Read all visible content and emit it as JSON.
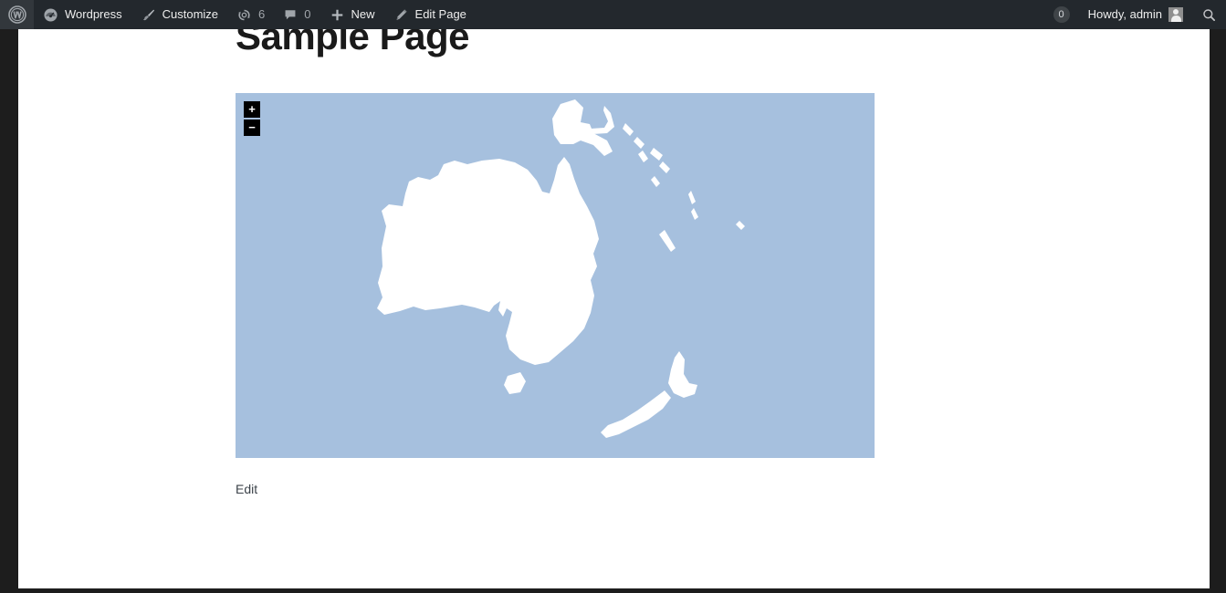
{
  "adminbar": {
    "items": [
      {
        "id": "wp-logo",
        "icon": "wordpress-logo-icon",
        "label": ""
      },
      {
        "id": "site-name",
        "icon": "dashboard-icon",
        "label": "Wordpress"
      },
      {
        "id": "customize",
        "icon": "paintbrush-icon",
        "label": "Customize"
      },
      {
        "id": "updates",
        "icon": "update-arrows-icon",
        "label": "6"
      },
      {
        "id": "comments",
        "icon": "comment-bubble-icon",
        "label": "0"
      },
      {
        "id": "new-content",
        "icon": "plus-icon",
        "label": "New"
      },
      {
        "id": "edit-page",
        "icon": "pencil-icon",
        "label": "Edit Page"
      }
    ],
    "notification_count": "0",
    "howdy": "Howdy, admin",
    "search_icon": "search-icon",
    "avatar_icon": "avatar-icon"
  },
  "page": {
    "title": "Sample Page",
    "edit_label": "Edit"
  },
  "map": {
    "zoom_in_label": "+",
    "zoom_out_label": "−",
    "ocean_color": "#a6c0de",
    "land_color": "#ffffff",
    "region": "Oceania"
  }
}
